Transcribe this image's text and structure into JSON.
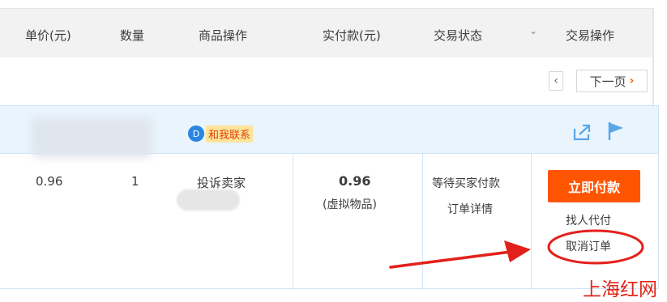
{
  "header": {
    "unit_price": "单价(元)",
    "quantity": "数量",
    "item_actions": "商品操作",
    "amount_paid": "实付款(元)",
    "trade_status": "交易状态",
    "status_caret": "⌄",
    "trade_actions": "交易操作"
  },
  "pager": {
    "prev_arrow": "‹",
    "next_label": "下一页",
    "next_arrow": "›"
  },
  "order": {
    "contact_badge": "D",
    "contact_label": "和我联系",
    "unit_price": "0.96",
    "quantity": "1",
    "complain_seller": "投诉卖家",
    "amount": "0.96",
    "amount_note": "(虚拟物品)",
    "status": "等待买家付款",
    "order_detail": "订单详情",
    "pay_now": "立即付款",
    "proxy_pay": "找人代付",
    "cancel_order": "取消订单"
  },
  "watermark": "上海红网",
  "colors": {
    "accent_orange": "#ff5500",
    "annotation_red": "#e3201b",
    "order_head_bg": "#e9f4fd",
    "link_blue": "#2a86e0"
  },
  "icons": [
    "share-icon",
    "flag-icon",
    "contact-bubble-icon",
    "annotation-arrow",
    "annotation-circle"
  ]
}
